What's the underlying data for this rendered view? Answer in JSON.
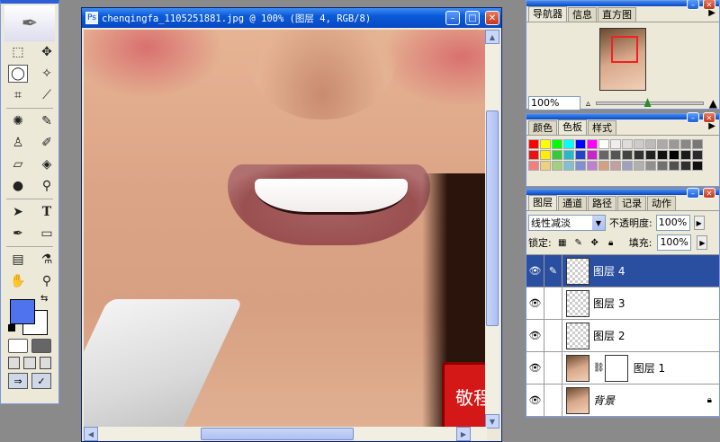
{
  "document": {
    "title": "chenqingfa_1105251881.jpg @ 100% (图层 4, RGB/8)",
    "seal_text": "敬程"
  },
  "toolbox": {
    "tools": [
      "marquee",
      "move",
      "lasso",
      "magic-wand",
      "crop",
      "slice",
      "healing",
      "brush",
      "stamp",
      "history-brush",
      "eraser",
      "paint-bucket",
      "blur",
      "dodge",
      "path-select",
      "type",
      "pen",
      "shape",
      "notes",
      "eyedropper",
      "hand",
      "zoom"
    ],
    "type_tool_label": "T",
    "foreground_color": "#4f73ee",
    "background_color": "#ffffff"
  },
  "navigator": {
    "tabs": [
      "导航器",
      "信息",
      "直方图"
    ],
    "zoom_value": "100%",
    "zoom_fraction": 0.48
  },
  "color_panel": {
    "tabs": [
      "颜色",
      "色板",
      "样式"
    ],
    "swatches": [
      "#ff0000",
      "#ffff00",
      "#00ff00",
      "#00ffff",
      "#0000ff",
      "#ff00ff",
      "#ffffff",
      "#eeeeee",
      "#dddddd",
      "#cccccc",
      "#bbbbbb",
      "#aaaaaa",
      "#999999",
      "#888888",
      "#777777",
      "#ee1111",
      "#ffee00",
      "#33cc33",
      "#22bbcc",
      "#2244cc",
      "#cc22cc",
      "#666666",
      "#555555",
      "#444444",
      "#333333",
      "#222222",
      "#111111",
      "#000000",
      "#1a1a1a",
      "#2a2a2a",
      "#f08080",
      "#f0d080",
      "#a0d080",
      "#80c0d0",
      "#8090d0",
      "#c080d0",
      "#d4a080",
      "#c0a0a0",
      "#a0a0c0",
      "#b0b0b0",
      "#909090",
      "#707070",
      "#505050",
      "#303030",
      "#101010"
    ]
  },
  "layers": {
    "tabs": [
      "图层",
      "通道",
      "路径",
      "记录",
      "动作"
    ],
    "blend_mode": "线性减淡",
    "opacity_label": "不透明度:",
    "opacity_value": "100%",
    "lock_label": "锁定:",
    "fill_label": "填充:",
    "fill_value": "100%",
    "items": [
      {
        "name": "图层 4",
        "selected": true
      },
      {
        "name": "图层 3"
      },
      {
        "name": "图层 2"
      },
      {
        "name": "图层 1"
      },
      {
        "name": "背景"
      }
    ]
  }
}
